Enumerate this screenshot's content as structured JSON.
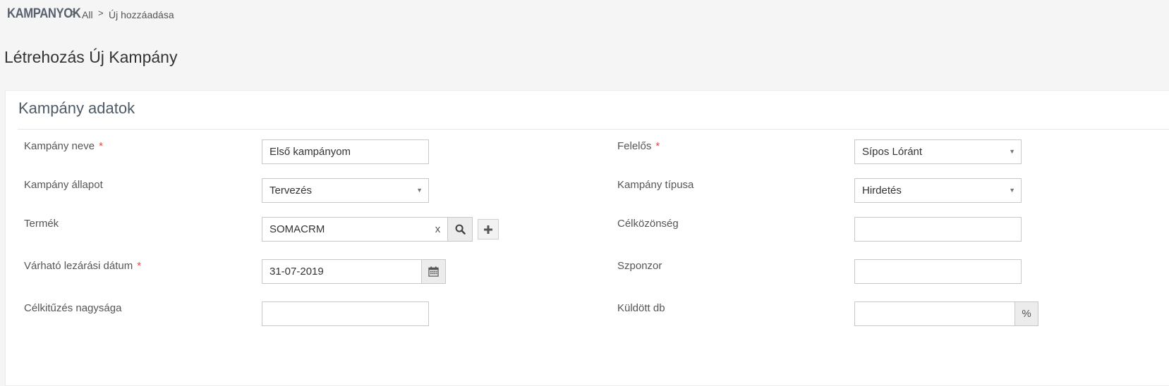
{
  "breadcrumb": {
    "brand": "KAMPANYOK",
    "items": [
      "All",
      "Új hozzáadása"
    ],
    "separator": ">"
  },
  "page_title": "Létrehozás Új Kampány",
  "panel": {
    "title": "Kampány adatok",
    "required_mark": "*",
    "left_fields": [
      {
        "label": "Kampány neve",
        "required": true,
        "value": "Első kampányom",
        "type": "text"
      },
      {
        "label": "Kampány állapot",
        "required": false,
        "value": "Tervezés",
        "type": "select"
      },
      {
        "label": "Termék",
        "required": false,
        "value": "SOMACRM",
        "type": "lookup",
        "clear_label": "x"
      },
      {
        "label": "Várható lezárási dátum",
        "required": true,
        "value": "31-07-2019",
        "type": "date"
      },
      {
        "label": "Célkitűzés nagysága",
        "required": false,
        "value": "",
        "type": "text"
      }
    ],
    "right_fields": [
      {
        "label": "Felelős",
        "required": true,
        "value": "Sípos Lóránt",
        "type": "select"
      },
      {
        "label": "Kampány típusa",
        "required": false,
        "value": "Hirdetés",
        "type": "select"
      },
      {
        "label": "Célközönség",
        "required": false,
        "value": "",
        "type": "text"
      },
      {
        "label": "Szponzor",
        "required": false,
        "value": "",
        "type": "text"
      },
      {
        "label": "Küldött db",
        "required": false,
        "value": "",
        "type": "percent",
        "addon": "%"
      }
    ]
  },
  "icons": {
    "caret": "caret-down-icon",
    "search": "search-icon",
    "add": "plus-icon",
    "calendar": "calendar-icon",
    "breadcrumb_sep": "chevron-right-icon"
  },
  "colors": {
    "required": "#e04848",
    "brand": "#57626e",
    "panel_title": "#4d5a66"
  }
}
